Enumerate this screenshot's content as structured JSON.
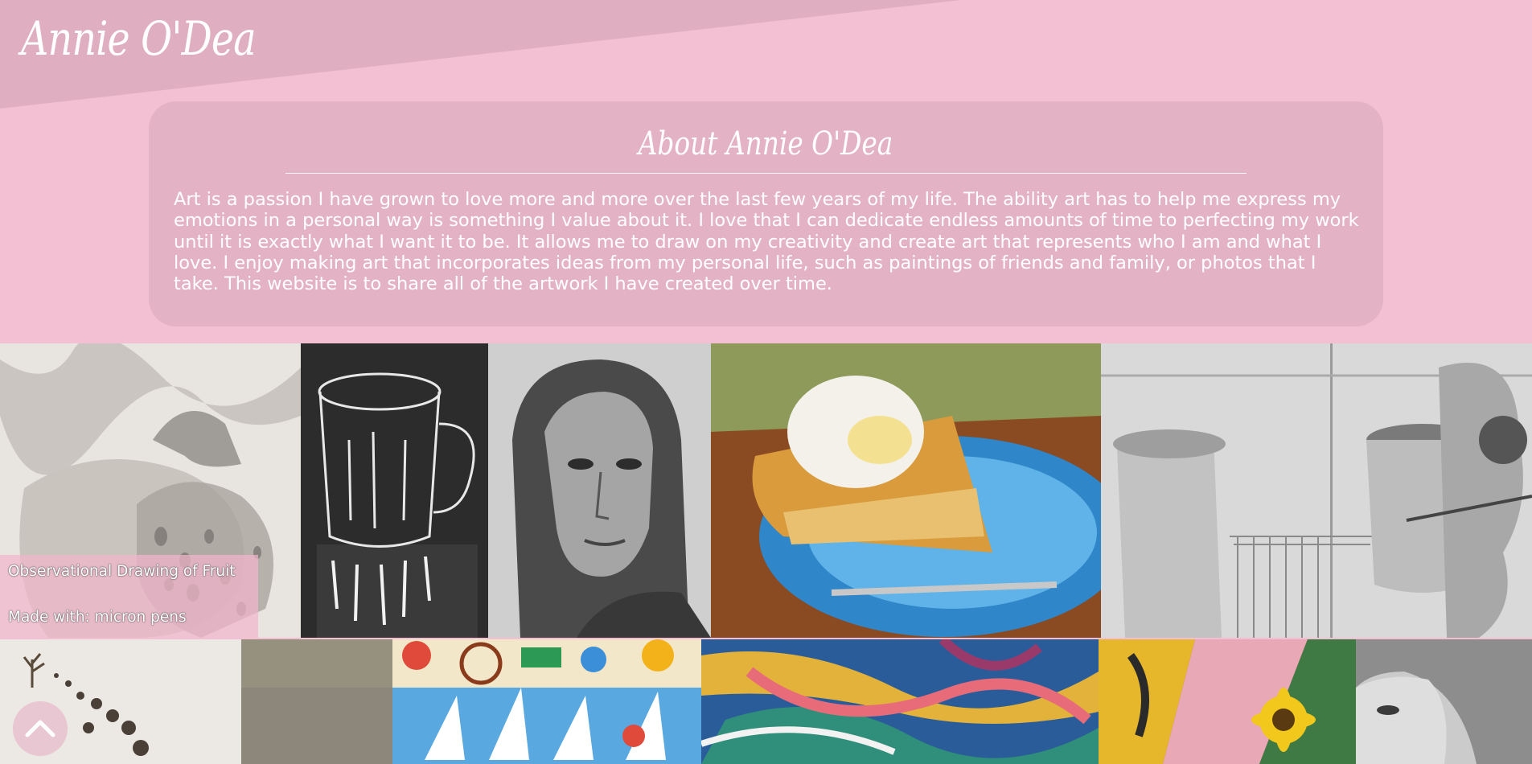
{
  "header": {
    "site_title": "Annie O'Dea"
  },
  "about": {
    "title": "About Annie O'Dea",
    "body": "Art is a passion I have grown to love more and more over the last few years of my life. The ability art has to help me express my emotions in a personal way is something I value about it. I love that I can dedicate endless amounts of time to perfecting my work until it is exactly what I want it to be. It allows me to draw on my creativity and create art that represents who I am and what I love. I enjoy making art that incorporates ideas from my personal life, such as paintings of friends and family, or photos that I take. This website is to share all of the artwork I have created over time."
  },
  "gallery": {
    "featured_caption": {
      "title": "Observational Drawing of Fruit",
      "medium": "Made with: micron pens"
    }
  },
  "controls": {
    "back_to_top_icon": "chevron-up-icon"
  },
  "colors": {
    "background": "#f2c0d2",
    "header_band": "#dfafc1",
    "text": "#ffffff"
  }
}
